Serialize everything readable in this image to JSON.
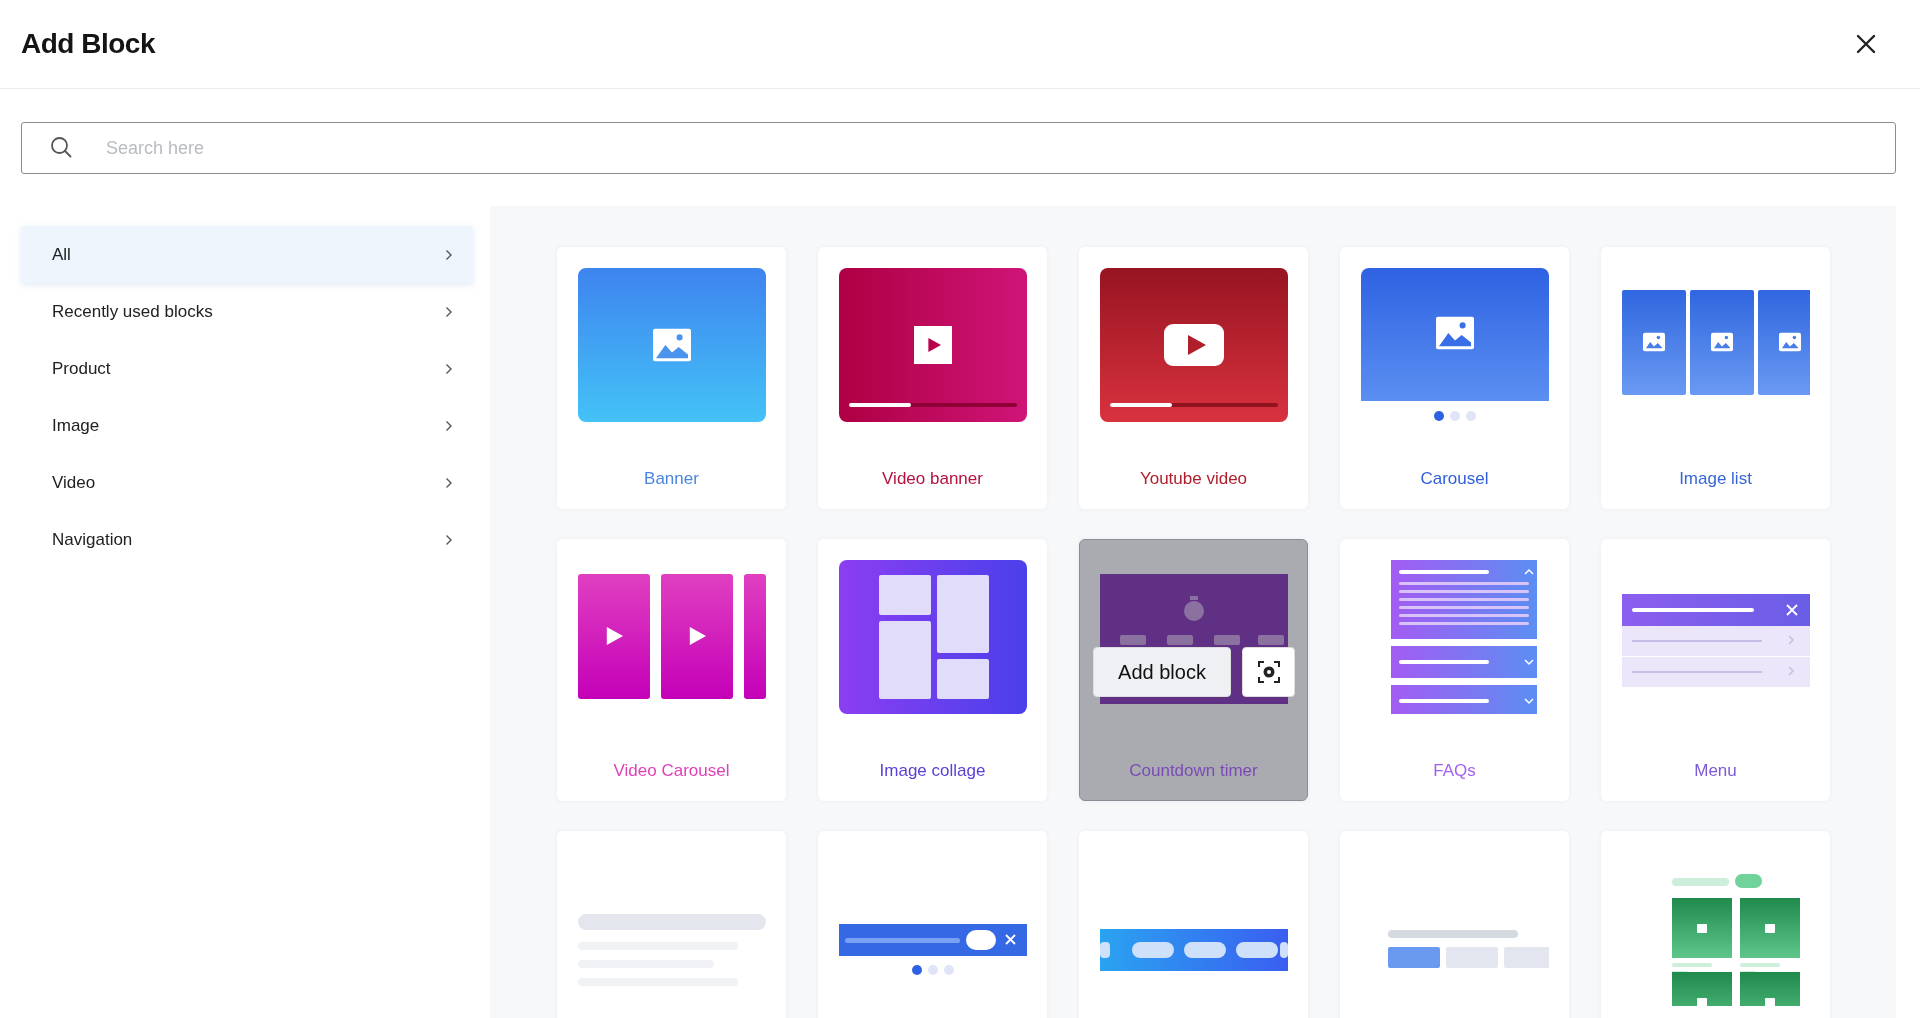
{
  "dialog": {
    "title": "Add Block"
  },
  "search": {
    "placeholder": "Search here"
  },
  "categories": [
    {
      "label": "All",
      "selected": true
    },
    {
      "label": "Recently used blocks",
      "selected": false
    },
    {
      "label": "Product",
      "selected": false
    },
    {
      "label": "Image",
      "selected": false
    },
    {
      "label": "Video",
      "selected": false
    },
    {
      "label": "Navigation",
      "selected": false
    }
  ],
  "blocks": [
    {
      "kind": "banner",
      "label": "Banner",
      "color": "#4a86e0",
      "hovered": false
    },
    {
      "kind": "video-banner",
      "label": "Video banner",
      "color": "#b3123f",
      "hovered": false
    },
    {
      "kind": "youtube",
      "label": "Youtube video",
      "color": "#b01e2c",
      "hovered": false
    },
    {
      "kind": "carousel",
      "label": "Carousel",
      "color": "#2f5fd8",
      "hovered": false
    },
    {
      "kind": "image-list",
      "label": "Image list",
      "color": "#3565d8",
      "hovered": false
    },
    {
      "kind": "video-carousel",
      "label": "Video Carousel",
      "color": "#e040b8",
      "hovered": false
    },
    {
      "kind": "collage",
      "label": "Image collage",
      "color": "#5b3fd6",
      "hovered": false
    },
    {
      "kind": "countdown",
      "label": "Countdown timer",
      "color": "#7b4bb5",
      "hovered": true
    },
    {
      "kind": "faq",
      "label": "FAQs",
      "color": "#a55ff0",
      "hovered": false
    },
    {
      "kind": "menu",
      "label": "Menu",
      "color": "#7b5ad8",
      "hovered": false
    },
    {
      "kind": "text",
      "hovered": false
    },
    {
      "kind": "announcement",
      "hovered": false
    },
    {
      "kind": "pills",
      "hovered": false
    },
    {
      "kind": "tabs",
      "hovered": false
    },
    {
      "kind": "product-grid",
      "hovered": false
    }
  ],
  "hover_actions": {
    "add_button": "Add block"
  }
}
